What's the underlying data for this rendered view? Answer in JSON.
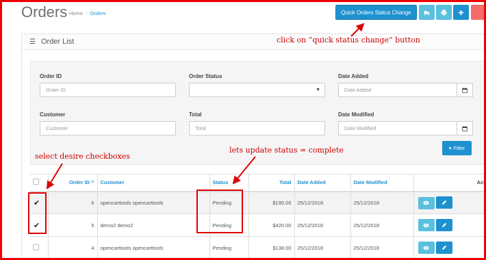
{
  "header": {
    "title": "Orders",
    "breadcrumb": [
      "Home",
      "Orders"
    ],
    "quick_status_button": "Quick Orders Status Change"
  },
  "panel": {
    "title": "Order List"
  },
  "filters": {
    "order_id": {
      "label": "Order ID",
      "placeholder": "Order ID"
    },
    "order_status": {
      "label": "Order Status",
      "value": ""
    },
    "date_added": {
      "label": "Date Added",
      "placeholder": "Date Added"
    },
    "customer": {
      "label": "Customer",
      "placeholder": "Customer"
    },
    "total": {
      "label": "Total",
      "placeholder": "Total"
    },
    "date_modified": {
      "label": "Date Modified",
      "placeholder": "Date Modified"
    },
    "filter_button": "Filter"
  },
  "table": {
    "headers": {
      "order_id": "Order ID",
      "customer": "Customer",
      "status": "Status",
      "total": "Total",
      "date_added": "Date Added",
      "date_modified": "Date Modified",
      "action": "Action"
    },
    "rows": [
      {
        "order_id": "6",
        "customer": "opencarttools opencarttools",
        "status": "Pending",
        "total": "$195.00",
        "date_added": "25/12/2018",
        "date_modified": "25/12/2018",
        "checked": true
      },
      {
        "order_id": "5",
        "customer": "demo2 demo2",
        "status": "Pending",
        "total": "$420.00",
        "date_added": "25/12/2018",
        "date_modified": "25/12/2018",
        "checked": true
      },
      {
        "order_id": "4",
        "customer": "opencarttools opencarttools",
        "status": "Pending",
        "total": "$138.00",
        "date_added": "25/12/2018",
        "date_modified": "25/12/2018",
        "checked": false
      }
    ]
  },
  "annotations": {
    "quick_status": "click on “quick status change” button",
    "checkboxes": "select desire checkboxes",
    "status_update": "lets update status = complete"
  },
  "colors": {
    "primary": "#1e91cf",
    "info": "#5bc0de",
    "danger": "#f56b6b",
    "annotation": "#cc0000"
  }
}
